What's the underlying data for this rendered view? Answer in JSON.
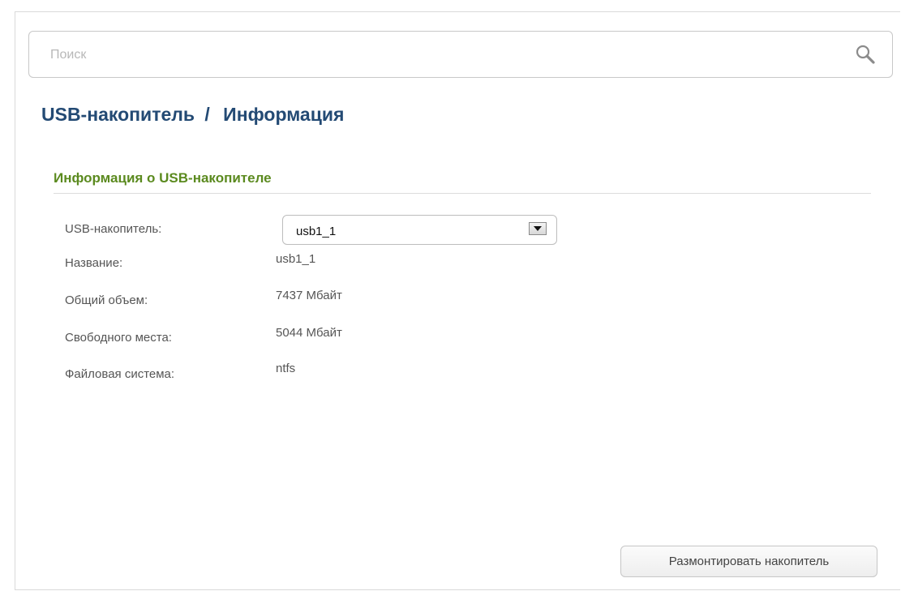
{
  "search": {
    "placeholder": "Поиск",
    "value": ""
  },
  "breadcrumb": {
    "section": "USB-накопитель",
    "separator": "/",
    "page": "Информация"
  },
  "info_section": {
    "title": "Информация о USB-накопителе",
    "rows": [
      {
        "label": "USB-накопитель:",
        "value": "usb1_1"
      },
      {
        "label": "Название:",
        "value": "usb1_1"
      },
      {
        "label": "Общий объем:",
        "value": "7437 Мбайт"
      },
      {
        "label": "Свободного места:",
        "value": "5044 Мбайт"
      },
      {
        "label": "Файловая система:",
        "value": "ntfs"
      }
    ]
  },
  "actions": {
    "unmount_label": "Размонтировать накопитель"
  },
  "icons": {
    "search": "search-icon",
    "dropdown": "chevron-down-icon"
  },
  "colors": {
    "title": "#234a74",
    "section_title": "#5b8a1f",
    "label": "#555555"
  }
}
